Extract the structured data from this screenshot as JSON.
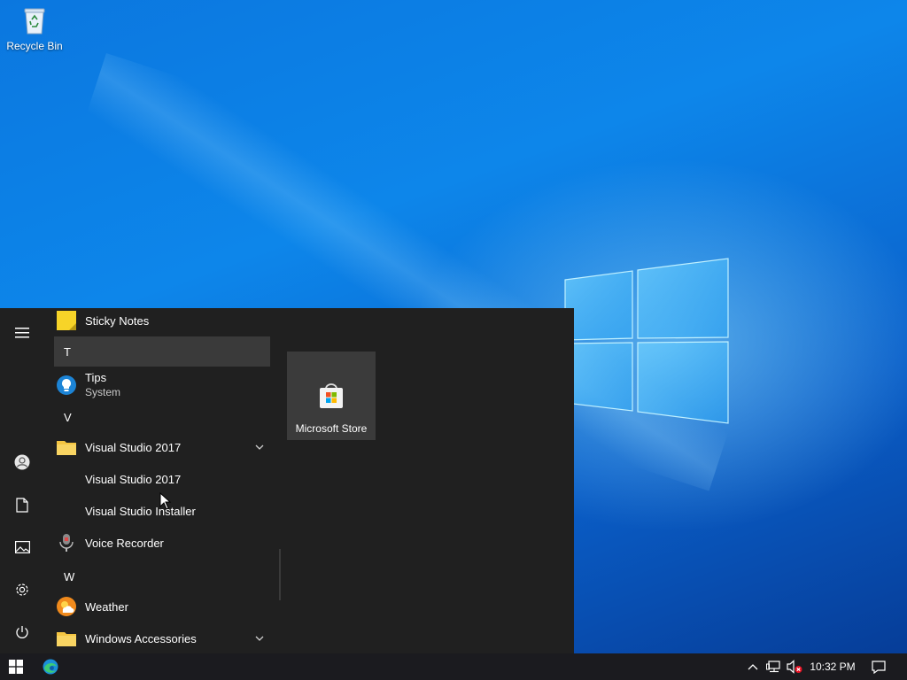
{
  "desktop": {
    "icons": [
      {
        "label": "Recycle Bin",
        "icon": "recycle-bin-icon"
      }
    ]
  },
  "start_menu": {
    "rail": {
      "menu": "hamburger-icon",
      "account": "user-icon",
      "documents": "document-icon",
      "pictures": "pictures-icon",
      "settings": "gear-icon",
      "power": "power-icon"
    },
    "apps": {
      "sticky_notes": "Sticky Notes",
      "letter_t": "T",
      "tips": "Tips",
      "tips_sub": "System",
      "letter_v": "V",
      "vs_folder": "Visual Studio 2017",
      "vs_app": "Visual Studio 2017",
      "vs_installer": "Visual Studio Installer",
      "voice_recorder": "Voice Recorder",
      "letter_w": "W",
      "weather": "Weather",
      "win_accessories": "Windows Accessories"
    },
    "tiles": [
      {
        "label": "Microsoft Store",
        "icon": "store-icon"
      }
    ]
  },
  "taskbar": {
    "start": "windows-icon",
    "pinned": [
      "edge-icon"
    ],
    "tray": {
      "overflow": "chevron-up-icon",
      "network": "network-icon",
      "volume": "volume-muted-icon"
    },
    "clock": "10:32 PM",
    "notifications": "notification-icon"
  },
  "colors": {
    "start_bg": "#202020",
    "taskbar_bg": "#1b1b1f",
    "tile_bg": "#3b3b3b",
    "selected_header": "#3a3a3a"
  }
}
